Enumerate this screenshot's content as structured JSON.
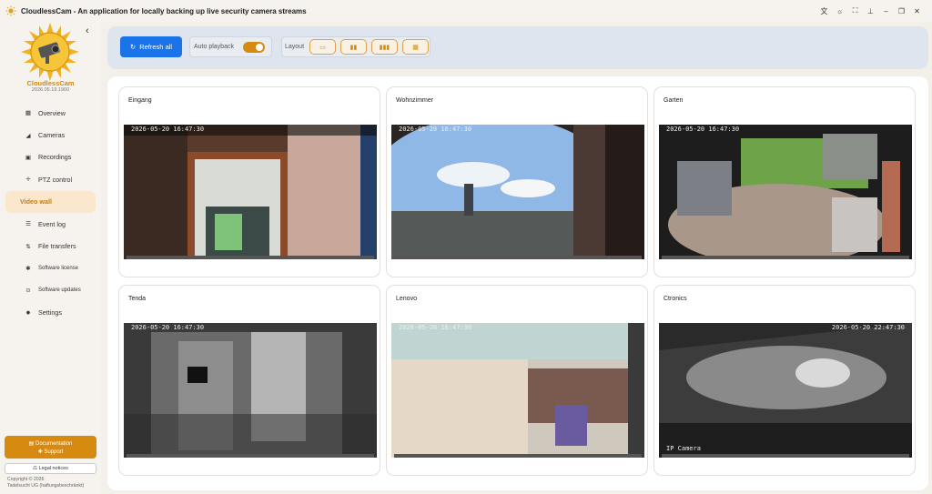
{
  "window": {
    "title": "CloudlessCam - An application for locally backing up live security camera streams",
    "icon": "sun-icon",
    "controls": [
      "translate-icon",
      "sleep-icon",
      "fullscreen-icon",
      "pin-icon",
      "minimize-icon",
      "restore-icon",
      "close-icon"
    ]
  },
  "sidebar": {
    "brand": "CloudlessCam",
    "version": "2026.05.19.1900",
    "items": [
      {
        "label": "Overview",
        "icon": "grid-icon"
      },
      {
        "label": "Cameras",
        "icon": "camera-icon"
      },
      {
        "label": "Recordings",
        "icon": "recording-icon"
      },
      {
        "label": "PTZ control",
        "icon": "move-icon"
      },
      {
        "label": "Video wall",
        "icon": "",
        "active": true
      },
      {
        "label": "Event log",
        "icon": "list-icon"
      },
      {
        "label": "File transfers",
        "icon": "transfer-icon"
      },
      {
        "label": "Software license",
        "icon": "license-icon"
      },
      {
        "label": "Software updates",
        "icon": "update-icon"
      },
      {
        "label": "Settings",
        "icon": "gear-icon"
      }
    ],
    "documentation_label": "Documentation",
    "support_label": "Support",
    "legal_label": "Legal notices",
    "copyright_line1": "Copyright © 2026",
    "copyright_line2": "Tadelsucht UG (haftungsbeschränkt)"
  },
  "toolbar": {
    "refresh_label": "Refresh all",
    "autoplay_label": "Auto playback",
    "autoplay_on": true,
    "layout_label": "Layout",
    "layout_options": [
      "single-view-icon",
      "two-view-icon",
      "three-view-icon",
      "four-view-icon"
    ]
  },
  "cameras": [
    {
      "name": "Eingang",
      "timestamp": "2026-05-20 16:47:30"
    },
    {
      "name": "Wohnzimmer",
      "timestamp": "2026-05-20 16:47:30"
    },
    {
      "name": "Garten",
      "timestamp": "2026-05-20 16:47:30"
    },
    {
      "name": "Tenda",
      "timestamp": "2026-05-20 16:47:30"
    },
    {
      "name": "Lenovo",
      "timestamp": "2026-05-20 16:47:30"
    },
    {
      "name": "Ctronics",
      "timestamp": "2026-05-20 22:47:30",
      "overlay": "IP Camera"
    }
  ],
  "colors": {
    "accent": "#d68a10",
    "primary": "#1a73e8",
    "active_bg": "#fbe7cd"
  }
}
